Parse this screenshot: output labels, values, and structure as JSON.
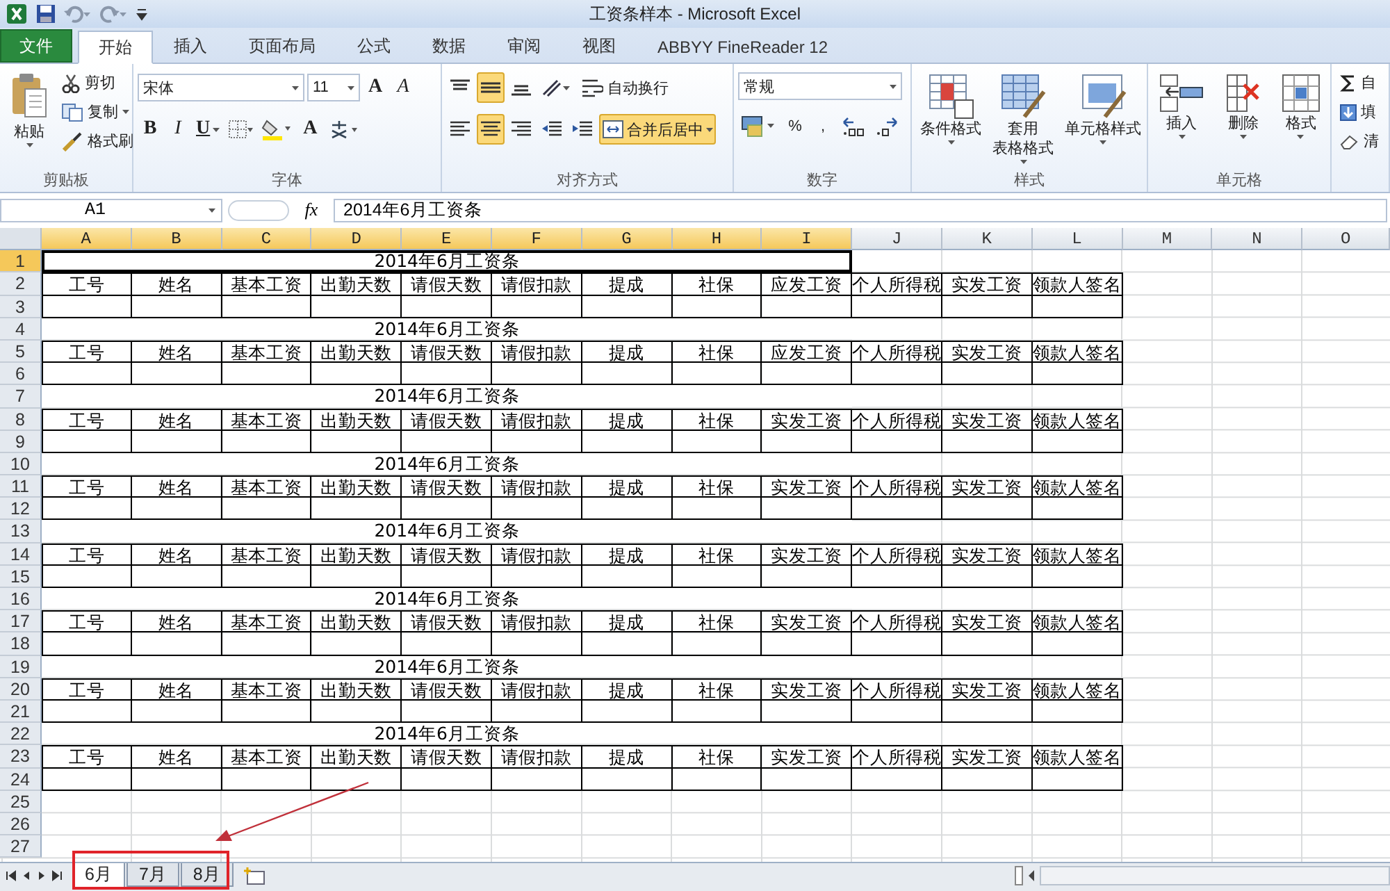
{
  "window": {
    "title": "工资条样本 - Microsoft Excel"
  },
  "ribbon_tabs": [
    {
      "label": "文件",
      "kind": "file",
      "selected": false
    },
    {
      "label": "开始",
      "kind": "tab",
      "selected": true
    },
    {
      "label": "插入",
      "kind": "tab",
      "selected": false
    },
    {
      "label": "页面布局",
      "kind": "tab",
      "selected": false
    },
    {
      "label": "公式",
      "kind": "tab",
      "selected": false
    },
    {
      "label": "数据",
      "kind": "tab",
      "selected": false
    },
    {
      "label": "审阅",
      "kind": "tab",
      "selected": false
    },
    {
      "label": "视图",
      "kind": "tab",
      "selected": false
    },
    {
      "label": "ABBYY FineReader 12",
      "kind": "tab",
      "selected": false
    }
  ],
  "ribbon": {
    "groups": [
      {
        "label": "剪贴板",
        "kind": "clipboard",
        "items": [
          {
            "kind": "large",
            "label": "粘贴"
          },
          {
            "kind": "small",
            "label": "剪切"
          },
          {
            "kind": "small",
            "label": "复制"
          },
          {
            "kind": "small",
            "label": "格式刷"
          }
        ]
      },
      {
        "label": "字体",
        "kind": "rows",
        "rows": [
          {
            "items": [
              {
                "kind": "field",
                "value": "宋体"
              },
              {
                "kind": "field",
                "value": "11"
              },
              {
                "kind": "tool",
                "label": "A"
              },
              {
                "kind": "tool",
                "label": "A"
              }
            ]
          },
          {
            "items": [
              {
                "kind": "tool",
                "label": "B"
              },
              {
                "kind": "tool",
                "label": "I"
              },
              {
                "kind": "tool",
                "label": "U"
              },
              {
                "kind": "tool"
              },
              {
                "kind": "tool"
              },
              {
                "kind": "tool",
                "label": "A"
              },
              {
                "kind": "tool"
              }
            ]
          }
        ]
      },
      {
        "label": "对齐方式",
        "kind": "rows",
        "rows": [
          {
            "items": [
              {
                "kind": "toggle",
                "on": false
              },
              {
                "kind": "toggle",
                "on": true
              },
              {
                "kind": "toggle",
                "on": false
              },
              {
                "kind": "tool"
              },
              {
                "kind": "small",
                "label": "自动换行"
              }
            ]
          },
          {
            "items": [
              {
                "kind": "toggle",
                "on": false
              },
              {
                "kind": "toggle",
                "on": true
              },
              {
                "kind": "toggle",
                "on": false
              },
              {
                "kind": "tool"
              },
              {
                "kind": "tool"
              },
              {
                "kind": "toggle",
                "label": "合并后居中",
                "on": true
              }
            ]
          }
        ]
      },
      {
        "label": "数字",
        "kind": "rows",
        "rows": [
          {
            "items": [
              {
                "kind": "field",
                "value": "常规"
              }
            ]
          },
          {
            "items": [
              {
                "kind": "tool"
              },
              {
                "kind": "tool",
                "label": "%"
              },
              {
                "kind": "tool",
                "label": ","
              },
              {
                "kind": "tool"
              },
              {
                "kind": "tool"
              }
            ]
          }
        ]
      },
      {
        "label": "样式",
        "kind": "buttons",
        "items": [
          {
            "kind": "large",
            "lines": [
              "条件格式"
            ]
          },
          {
            "kind": "large",
            "lines": [
              "套用",
              "表格格式"
            ]
          },
          {
            "kind": "large",
            "lines": [
              "单元格样式"
            ]
          }
        ]
      },
      {
        "label": "单元格",
        "kind": "buttons",
        "items": [
          {
            "kind": "large",
            "lines": [
              "插入"
            ]
          },
          {
            "kind": "large",
            "lines": [
              "删除"
            ]
          },
          {
            "kind": "large",
            "lines": [
              "格式"
            ]
          }
        ]
      },
      {
        "kind": "stack",
        "items": [
          {
            "kind": "small",
            "label": "自"
          },
          {
            "kind": "small",
            "label": "填"
          },
          {
            "kind": "small",
            "label": "清"
          }
        ]
      }
    ]
  },
  "formula_bar": {
    "name_box": "A1",
    "fx": "fx",
    "formula": "2014年6月工资条"
  },
  "sheet": {
    "columns": [
      {
        "label": "A",
        "selected": true
      },
      {
        "label": "B",
        "selected": true
      },
      {
        "label": "C",
        "selected": true
      },
      {
        "label": "D",
        "selected": true
      },
      {
        "label": "E",
        "selected": true
      },
      {
        "label": "F",
        "selected": true
      },
      {
        "label": "G",
        "selected": true
      },
      {
        "label": "H",
        "selected": true
      },
      {
        "label": "I",
        "selected": true
      },
      {
        "label": "J",
        "selected": false
      },
      {
        "label": "K",
        "selected": false
      },
      {
        "label": "L",
        "selected": false
      },
      {
        "label": "M",
        "selected": false
      },
      {
        "label": "N",
        "selected": false
      },
      {
        "label": "O",
        "selected": false
      }
    ],
    "rows": [
      {
        "number": "1",
        "selected": true,
        "kind": "title",
        "cells": [
          "2014年6月工资条"
        ]
      },
      {
        "number": "2",
        "selected": false,
        "kind": "header",
        "cells": [
          "工号",
          "姓名",
          "基本工资",
          "出勤天数",
          "请假天数",
          "请假扣款",
          "提成",
          "社保",
          "应发工资",
          "个人所得税",
          "实发工资",
          "领款人签名"
        ]
      },
      {
        "number": "3",
        "selected": false,
        "kind": "record"
      },
      {
        "number": "4",
        "selected": false,
        "kind": "title",
        "cells": [
          "2014年6月工资条"
        ]
      },
      {
        "number": "5",
        "selected": false,
        "kind": "header",
        "cells": [
          "工号",
          "姓名",
          "基本工资",
          "出勤天数",
          "请假天数",
          "请假扣款",
          "提成",
          "社保",
          "应发工资",
          "个人所得税",
          "实发工资",
          "领款人签名"
        ]
      },
      {
        "number": "6",
        "selected": false,
        "kind": "record"
      },
      {
        "number": "7",
        "selected": false,
        "kind": "title",
        "cells": [
          "2014年6月工资条"
        ]
      },
      {
        "number": "8",
        "selected": false,
        "kind": "header",
        "cells": [
          "工号",
          "姓名",
          "基本工资",
          "出勤天数",
          "请假天数",
          "请假扣款",
          "提成",
          "社保",
          "实发工资",
          "个人所得税",
          "实发工资",
          "领款人签名"
        ]
      },
      {
        "number": "9",
        "selected": false,
        "kind": "record"
      },
      {
        "number": "10",
        "selected": false,
        "kind": "title",
        "cells": [
          "2014年6月工资条"
        ]
      },
      {
        "number": "11",
        "selected": false,
        "kind": "header",
        "cells": [
          "工号",
          "姓名",
          "基本工资",
          "出勤天数",
          "请假天数",
          "请假扣款",
          "提成",
          "社保",
          "实发工资",
          "个人所得税",
          "实发工资",
          "领款人签名"
        ]
      },
      {
        "number": "12",
        "selected": false,
        "kind": "record"
      },
      {
        "number": "13",
        "selected": false,
        "kind": "title",
        "cells": [
          "2014年6月工资条"
        ]
      },
      {
        "number": "14",
        "selected": false,
        "kind": "header",
        "cells": [
          "工号",
          "姓名",
          "基本工资",
          "出勤天数",
          "请假天数",
          "请假扣款",
          "提成",
          "社保",
          "实发工资",
          "个人所得税",
          "实发工资",
          "领款人签名"
        ]
      },
      {
        "number": "15",
        "selected": false,
        "kind": "record"
      },
      {
        "number": "16",
        "selected": false,
        "kind": "title",
        "cells": [
          "2014年6月工资条"
        ]
      },
      {
        "number": "17",
        "selected": false,
        "kind": "header",
        "cells": [
          "工号",
          "姓名",
          "基本工资",
          "出勤天数",
          "请假天数",
          "请假扣款",
          "提成",
          "社保",
          "实发工资",
          "个人所得税",
          "实发工资",
          "领款人签名"
        ]
      },
      {
        "number": "18",
        "selected": false,
        "kind": "record"
      },
      {
        "number": "19",
        "selected": false,
        "kind": "title",
        "cells": [
          "2014年6月工资条"
        ]
      },
      {
        "number": "20",
        "selected": false,
        "kind": "header",
        "cells": [
          "工号",
          "姓名",
          "基本工资",
          "出勤天数",
          "请假天数",
          "请假扣款",
          "提成",
          "社保",
          "实发工资",
          "个人所得税",
          "实发工资",
          "领款人签名"
        ]
      },
      {
        "number": "21",
        "selected": false,
        "kind": "record"
      },
      {
        "number": "22",
        "selected": false,
        "kind": "title",
        "cells": [
          "2014年6月工资条"
        ]
      },
      {
        "number": "23",
        "selected": false,
        "kind": "header",
        "cells": [
          "工号",
          "姓名",
          "基本工资",
          "出勤天数",
          "请假天数",
          "请假扣款",
          "提成",
          "社保",
          "实发工资",
          "个人所得税",
          "实发工资",
          "领款人签名"
        ]
      },
      {
        "number": "24",
        "selected": false,
        "kind": "record"
      },
      {
        "number": "25",
        "selected": false,
        "kind": "empty"
      },
      {
        "number": "26",
        "selected": false,
        "kind": "empty"
      },
      {
        "number": "27",
        "selected": false,
        "kind": "empty"
      }
    ]
  },
  "sheet_tabs": [
    {
      "label": "6月",
      "selected": true
    },
    {
      "label": "7月",
      "selected": false
    },
    {
      "label": "8月",
      "selected": false
    }
  ]
}
